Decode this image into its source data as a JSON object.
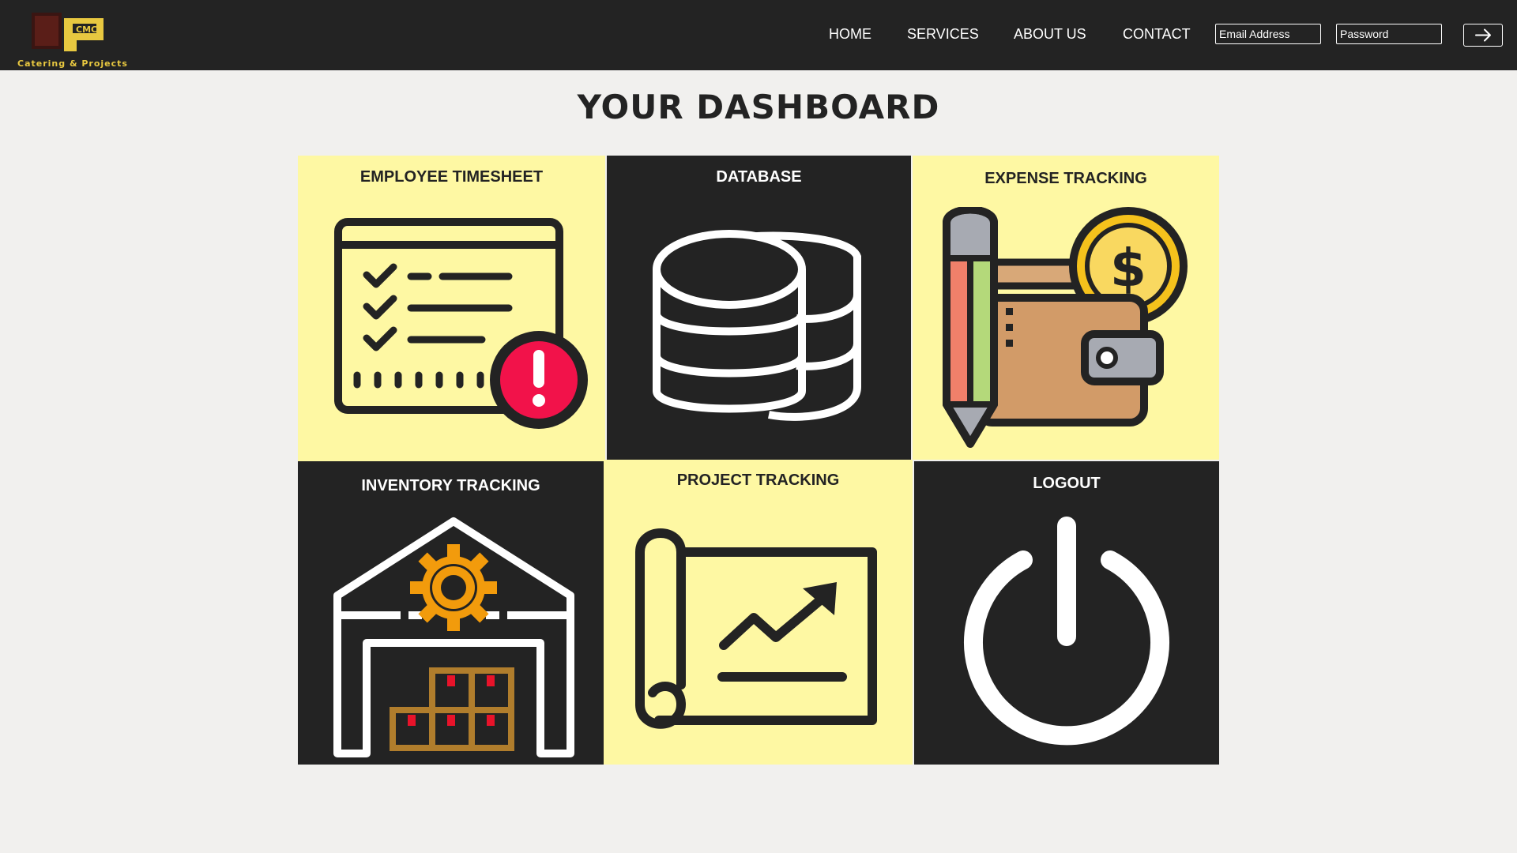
{
  "header": {
    "logo_text": "Catering & Projects",
    "logo_mark": "CMC",
    "nav": [
      "HOME",
      "SERVICES",
      "ABOUT US",
      "CONTACT"
    ],
    "email_placeholder": "Email Address",
    "password_placeholder": "Password",
    "submit_icon": "arrow-right-icon"
  },
  "page_title": "YOUR DASHBOARD",
  "tiles": [
    {
      "label": "EMPLOYEE TIMESHEET",
      "icon": "timesheet-checklist-icon"
    },
    {
      "label": "DATABASE",
      "icon": "database-icon"
    },
    {
      "label": "EXPENSE TRACKING",
      "icon": "wallet-coin-pencil-icon"
    },
    {
      "label": "INVENTORY TRACKING",
      "icon": "warehouse-icon"
    },
    {
      "label": "PROJECT TRACKING",
      "icon": "blueprint-chart-icon"
    },
    {
      "label": "LOGOUT",
      "icon": "power-icon"
    }
  ],
  "colors": {
    "topbar": "#232323",
    "tile_light": "#fef8a3",
    "tile_dark": "#232323",
    "background": "#f1f0ee",
    "alert_red": "#f2124a",
    "accent_orange": "#f29b0c"
  }
}
